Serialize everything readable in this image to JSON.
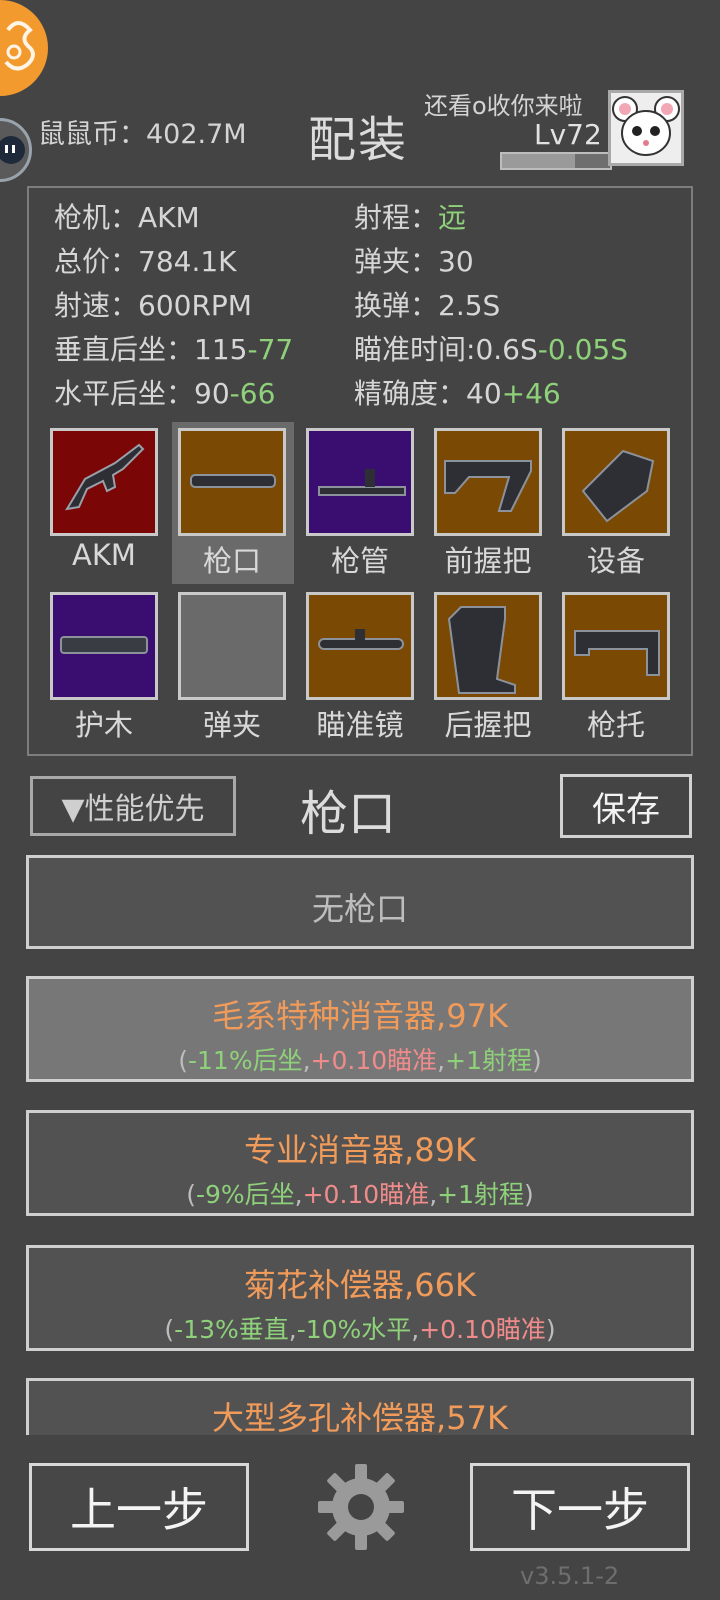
{
  "header": {
    "coins_label": "鼠鼠币：402.7M",
    "title": "配装",
    "player_name": "还看o收你来啦",
    "level": "Lv72",
    "xp_progress": 0.68
  },
  "stats": {
    "gun": {
      "label": "枪机：",
      "value": "AKM"
    },
    "range": {
      "label": "射程：",
      "value": "远"
    },
    "total_price": {
      "label": "总价：",
      "value": "784.1K"
    },
    "magazine": {
      "label": "弹夹：",
      "value": "30"
    },
    "fire_rate": {
      "label": "射速：",
      "value": "600RPM"
    },
    "reload": {
      "label": "换弹：",
      "value": "2.5S"
    },
    "vertical_recoil": {
      "label": "垂直后坐：",
      "base": "115",
      "delta": "-77"
    },
    "aim_time": {
      "label": "瞄准时间:",
      "base": "0.6S",
      "delta": "-0.05S"
    },
    "horizontal_recoil": {
      "label": "水平后坐：",
      "base": "90",
      "delta": "-66"
    },
    "accuracy": {
      "label": "精确度：",
      "base": "40",
      "delta": "+46"
    }
  },
  "slots": [
    {
      "label": "AKM",
      "icon": "akm-rifle-icon",
      "bg": "#7a0606"
    },
    {
      "label": "枪口",
      "icon": "muzzle-icon",
      "bg": "#7a4a05"
    },
    {
      "label": "枪管",
      "icon": "barrel-icon",
      "bg": "#3a0e70"
    },
    {
      "label": "前握把",
      "icon": "foregrip-icon",
      "bg": "#7a4a05"
    },
    {
      "label": "设备",
      "icon": "device-icon",
      "bg": "#7a4a05"
    },
    {
      "label": "护木",
      "icon": "handguard-icon",
      "bg": "#3a0e70"
    },
    {
      "label": "弹夹",
      "icon": "empty-slot-icon",
      "bg": "#6a6a6a"
    },
    {
      "label": "瞄准镜",
      "icon": "scope-icon",
      "bg": "#7a4a05"
    },
    {
      "label": "后握把",
      "icon": "pistol-grip-icon",
      "bg": "#7a4a05"
    },
    {
      "label": "枪托",
      "icon": "stock-icon",
      "bg": "#7a4a05"
    }
  ],
  "controls": {
    "sort_label": "▼性能优先",
    "category_title": "枪口",
    "save_label": "保存"
  },
  "items": [
    {
      "name": "无枪口"
    },
    {
      "name": "毛系特种消音器,97K",
      "d1": "-11%后坐",
      "d2": "+0.10瞄准",
      "d3": "+1射程"
    },
    {
      "name": "专业消音器,89K",
      "d1": "-9%后坐",
      "d2": "+0.10瞄准",
      "d3": "+1射程"
    },
    {
      "name": "菊花补偿器,66K",
      "d1": "-13%垂直",
      "d2": "-10%水平",
      "d3": "+0.10瞄准"
    },
    {
      "name": "大型多孔补偿器,57K"
    }
  ],
  "punct": {
    "open": "(",
    "comma": ",",
    "close": ")"
  },
  "bottom": {
    "prev_label": "上一步",
    "next_label": "下一步",
    "settings_icon": "gear-icon",
    "version": "v3.5.1-2"
  },
  "colors": {
    "background": "#444444",
    "accent_orange": "#f19b5a",
    "positive_green": "#8fd17a",
    "negative_red": "#f08b8b",
    "rarity_red": "#7a0606",
    "rarity_orange": "#7a4a05",
    "rarity_purple": "#3a0e70"
  }
}
